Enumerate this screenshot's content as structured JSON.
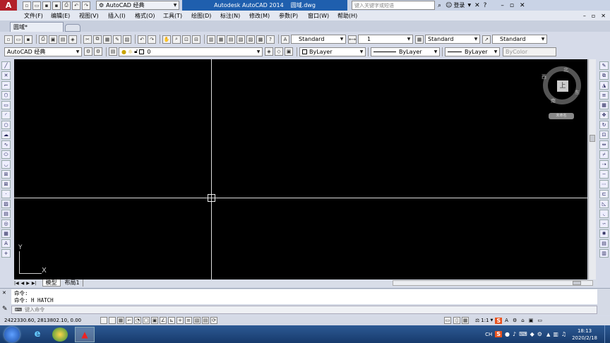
{
  "title_bar": {
    "app_logo": "A",
    "workspace": "AutoCAD 经典",
    "app_title": "Autodesk AutoCAD 2014",
    "file_name": "圆域.dwg",
    "search_placeholder": "键入关键字或短语",
    "login_label": "登录"
  },
  "menu": [
    "文件(F)",
    "编辑(E)",
    "视图(V)",
    "插入(I)",
    "格式(O)",
    "工具(T)",
    "绘图(D)",
    "标注(N)",
    "修改(M)",
    "参数(P)",
    "窗口(W)",
    "帮助(H)"
  ],
  "doc_tab": {
    "name": "圆域*"
  },
  "styles": {
    "text_style": "Standard",
    "dim_style": "1",
    "table_style": "Standard",
    "multileader_style": "Standard"
  },
  "layers": {
    "workspace": "AutoCAD 经典",
    "current_layer": "0",
    "color": "ByLayer",
    "linetype": "ByLayer",
    "lineweight": "ByLayer",
    "plot_style": "ByColor"
  },
  "viewcube": {
    "face": "上",
    "north": "北",
    "south": "南",
    "east": "东",
    "west": "西",
    "wcs": "未命名"
  },
  "ucs": {
    "x": "X",
    "y": "Y"
  },
  "layout_tabs": [
    "模型",
    "布局1"
  ],
  "command": {
    "history": [
      "命令:",
      "命令: H HATCH"
    ],
    "prompt": "键入命令"
  },
  "status": {
    "coords": "2422330.60, 2813802.10, 0.00",
    "scale": "1:1"
  },
  "tray": {
    "ime": "CH",
    "time": "18:13",
    "date": "2020/2/18"
  },
  "colors": {
    "canvas": "#000000",
    "title_blue": "#1f5fae",
    "taskbar": "#1b3f73",
    "ribbon": "#d6dbe9"
  }
}
